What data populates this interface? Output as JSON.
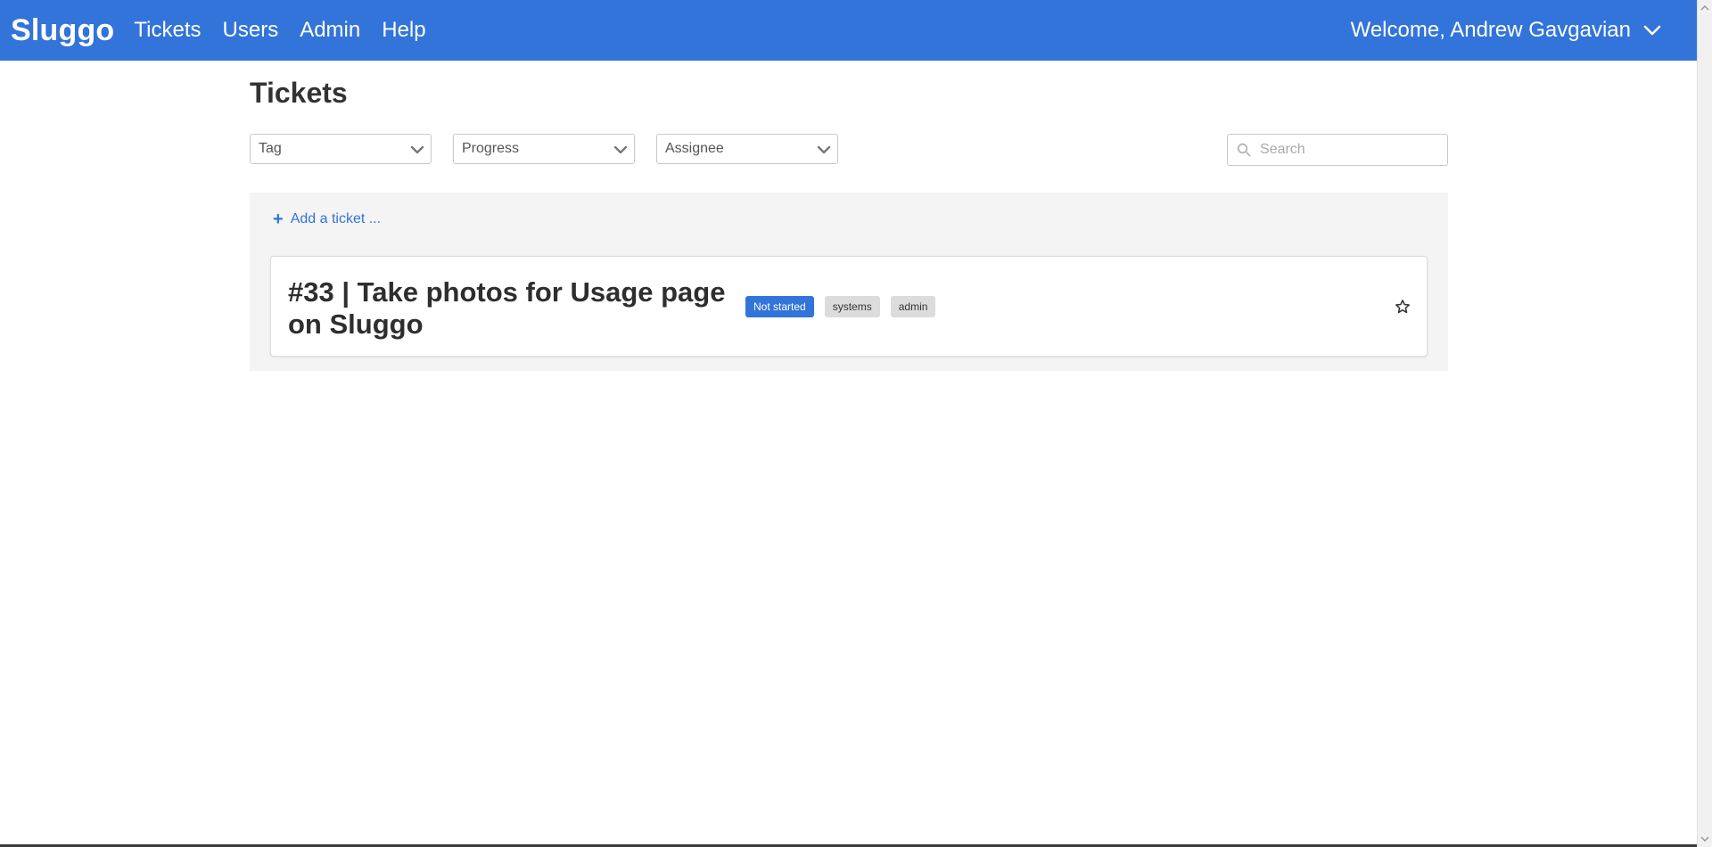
{
  "navbar": {
    "brand": "Sluggo",
    "links": [
      "Tickets",
      "Users",
      "Admin",
      "Help"
    ],
    "welcome": "Welcome, Andrew Gavgavian"
  },
  "page": {
    "title": "Tickets"
  },
  "filters": {
    "tag": "Tag",
    "progress": "Progress",
    "assignee": "Assignee",
    "search_placeholder": "Search"
  },
  "panel": {
    "add_ticket": "Add a ticket ..."
  },
  "tickets": [
    {
      "title": "#33 | Take photos for Usage page on Sluggo",
      "status": "Not started",
      "tags": [
        "systems",
        "admin"
      ],
      "starred": false
    }
  ],
  "colors": {
    "accent": "#3274d9",
    "tag_bg": "#dcdcdc",
    "panel_bg": "#f4f4f4"
  }
}
